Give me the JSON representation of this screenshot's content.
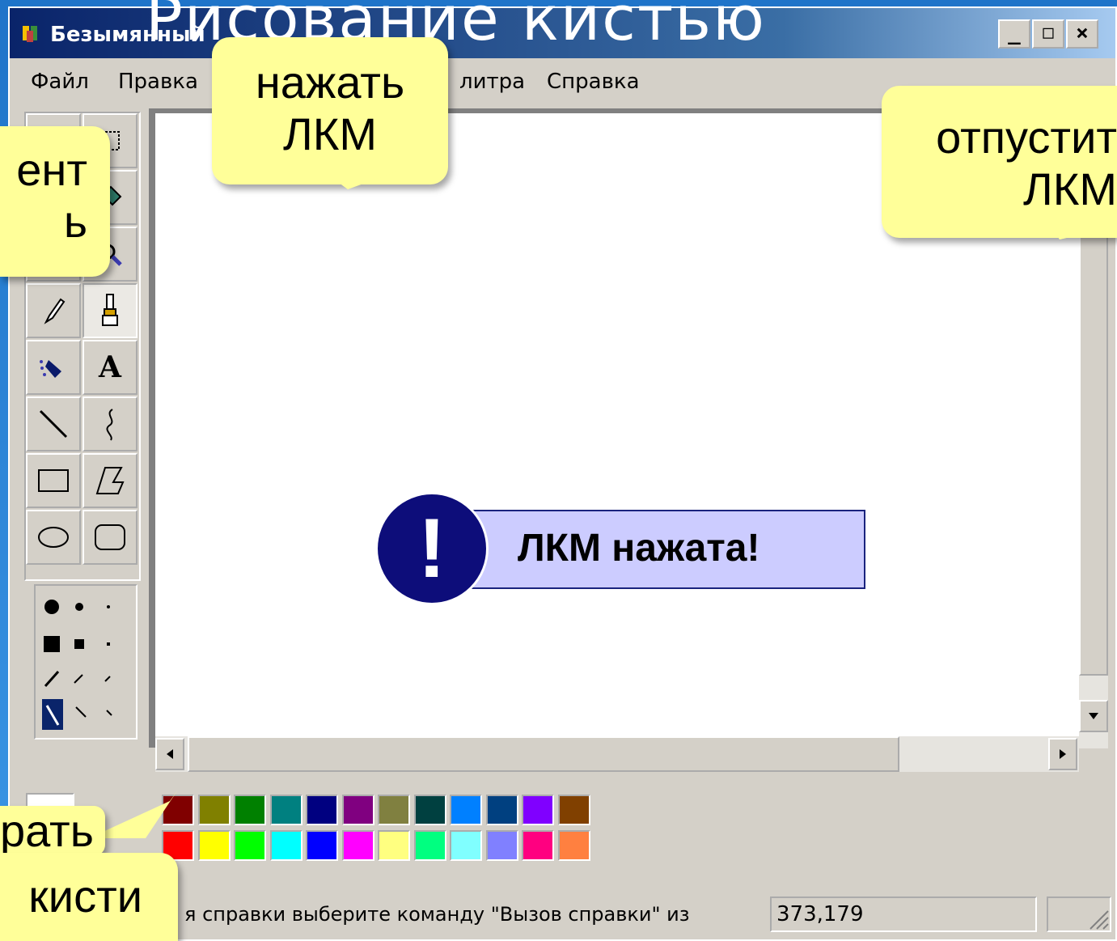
{
  "slide": {
    "title": "Рисование кистью"
  },
  "window": {
    "title": "Безымянный",
    "controls": {
      "minimize": "_",
      "maximize": "□",
      "close": "×"
    }
  },
  "menu": [
    "Файл",
    "Правка",
    "литра",
    "Справка"
  ],
  "tools": [
    {
      "name": "free-select",
      "icon": "free-select-icon"
    },
    {
      "name": "select",
      "icon": "rect-select-icon"
    },
    {
      "name": "eraser",
      "icon": "eraser-icon"
    },
    {
      "name": "fill",
      "icon": "fill-bucket-icon"
    },
    {
      "name": "eyedropper",
      "icon": "eyedropper-icon"
    },
    {
      "name": "magnifier",
      "icon": "magnifier-icon"
    },
    {
      "name": "pencil",
      "icon": "pencil-icon"
    },
    {
      "name": "brush",
      "icon": "brush-icon",
      "selected": true
    },
    {
      "name": "airbrush",
      "icon": "airbrush-icon"
    },
    {
      "name": "text",
      "icon": "text-icon",
      "label": "A"
    },
    {
      "name": "line",
      "icon": "line-icon"
    },
    {
      "name": "curve",
      "icon": "curve-icon"
    },
    {
      "name": "rectangle",
      "icon": "rectangle-icon"
    },
    {
      "name": "polygon",
      "icon": "polygon-icon"
    },
    {
      "name": "ellipse",
      "icon": "ellipse-icon"
    },
    {
      "name": "rounded-rectangle",
      "icon": "rounded-rectangle-icon"
    }
  ],
  "palette": {
    "top_row": [
      "#800000",
      "#808000",
      "#008000",
      "#008080",
      "#000080",
      "#800080",
      "#808040",
      "#004040",
      "#0080ff",
      "#004080",
      "#8000ff",
      "#804000"
    ],
    "bottom_row": [
      "#ff0000",
      "#ffff00",
      "#00ff00",
      "#00ffff",
      "#0000ff",
      "#ff00ff",
      "#ffff80",
      "#00ff80",
      "#80ffff",
      "#8080ff",
      "#ff0080",
      "#ff8040"
    ]
  },
  "status": {
    "text": "я справки выберите команду \"Вызов справки\" из",
    "coords": "373,179"
  },
  "callouts": {
    "press": "нажать\nЛКМ",
    "release": "отпустит\nЛКМ",
    "tool": "ент\nь",
    "brush_size_top": "рать",
    "brush_size_bottom": "кисти"
  },
  "alert": {
    "mark": "!",
    "text": "ЛКМ нажата!"
  },
  "colors": {
    "titlebar_dark": "#0a246a",
    "callout_fill": "#ffff99",
    "alert_fill": "#ccccff",
    "alert_circle": "#0d0d7a"
  }
}
